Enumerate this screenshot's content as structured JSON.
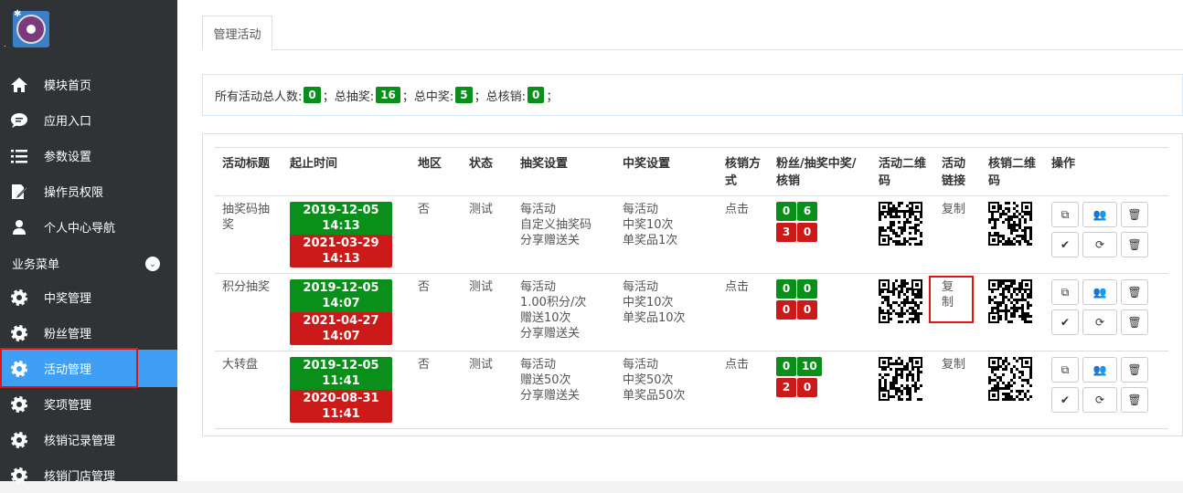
{
  "sidebar": {
    "items": [
      {
        "label": "模块首页",
        "icon": "home-icon"
      },
      {
        "label": "应用入口",
        "icon": "chat-icon"
      },
      {
        "label": "参数设置",
        "icon": "list-icon"
      },
      {
        "label": "操作员权限",
        "icon": "edit-icon"
      },
      {
        "label": "个人中心导航",
        "icon": "user-icon"
      }
    ],
    "section": "业务菜单",
    "sub_items": [
      {
        "label": "中奖管理"
      },
      {
        "label": "粉丝管理"
      },
      {
        "label": "活动管理",
        "active": true
      },
      {
        "label": "奖项管理"
      },
      {
        "label": "核销记录管理"
      },
      {
        "label": "核销门店管理"
      }
    ]
  },
  "tab": "管理活动",
  "stats": {
    "label1": "所有活动总人数:",
    "v1": "0",
    "label2": "；总抽奖:",
    "v2": "16",
    "label3": "；总中奖:",
    "v3": "5",
    "label4": "；总核销:",
    "v4": "0",
    "tail": "；"
  },
  "table": {
    "headers": [
      "活动标题",
      "起止时间",
      "地区",
      "状态",
      "抽奖设置",
      "中奖设置",
      "核销方式",
      "粉丝/抽奖中奖/核销",
      "活动二维码",
      "活动链接",
      "核销二维码",
      "操作"
    ],
    "rows": [
      {
        "title": "抽奖码抽奖",
        "start": "2019-12-05 14:13",
        "end": "2021-03-29 14:13",
        "region": "否",
        "status": "测试",
        "draw": [
          "每活动",
          "自定义抽奖码",
          "分享赠送关"
        ],
        "win": [
          "每活动",
          "中奖10次",
          "单奖品1次"
        ],
        "verify": "点击",
        "fans": "0",
        "draws": "6",
        "wins": "3",
        "verified": "0",
        "link": "复制"
      },
      {
        "title": "积分抽奖",
        "start": "2019-12-05 14:07",
        "end": "2021-04-27 14:07",
        "region": "否",
        "status": "测试",
        "draw": [
          "每活动",
          "1.00积分/次",
          "赠送10次",
          "分享赠送关"
        ],
        "win": [
          "每活动",
          "中奖10次",
          "单奖品10次"
        ],
        "verify": "点击",
        "fans": "0",
        "draws": "0",
        "wins": "0",
        "verified": "0",
        "link": "复制"
      },
      {
        "title": "大转盘",
        "start": "2019-12-05 11:41",
        "end": "2020-08-31 11:41",
        "region": "否",
        "status": "测试",
        "draw": [
          "每活动",
          "赠送50次",
          "分享赠送关"
        ],
        "win": [
          "每活动",
          "中奖50次",
          "单奖品50次"
        ],
        "verify": "点击",
        "fans": "0",
        "draws": "10",
        "wins": "2",
        "verified": "0",
        "link": "复制"
      }
    ]
  },
  "colors": {
    "sidebar_bg": "#2f3336",
    "active_bg": "#3f9ff5",
    "green": "#0a8f1a",
    "red": "#cc1a1a"
  }
}
